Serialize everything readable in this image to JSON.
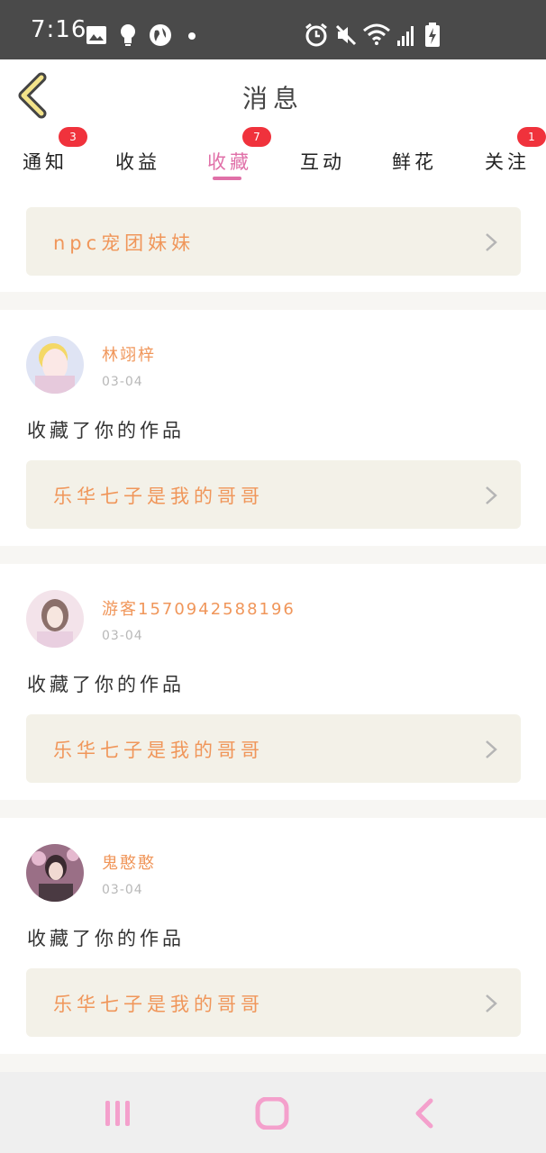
{
  "status_bar": {
    "time": "7:16"
  },
  "header": {
    "title": "消息"
  },
  "tabs": [
    {
      "label": "通知",
      "badge": "3",
      "active": false
    },
    {
      "label": "收益",
      "badge": "",
      "active": false
    },
    {
      "label": "收藏",
      "badge": "7",
      "active": true
    },
    {
      "label": "互动",
      "badge": "",
      "active": false
    },
    {
      "label": "鲜花",
      "badge": "",
      "active": false
    },
    {
      "label": "关注",
      "badge": "1",
      "active": false
    }
  ],
  "top_link": {
    "label": "npc宠团妹妹"
  },
  "messages": [
    {
      "user": "林翊梓",
      "date": "03-04",
      "action": "收藏了你的作品",
      "work": "乐华七子是我的哥哥"
    },
    {
      "user": "游客1570942588196",
      "date": "03-04",
      "action": "收藏了你的作品",
      "work": "乐华七子是我的哥哥"
    },
    {
      "user": "鬼憨憨",
      "date": "03-04",
      "action": "收藏了你的作品",
      "work": "乐华七子是我的哥哥"
    }
  ],
  "colors": {
    "accent": "#e070a8",
    "name": "#f0965a",
    "badge": "#f0323c",
    "link_bg": "#f3f1e8"
  }
}
